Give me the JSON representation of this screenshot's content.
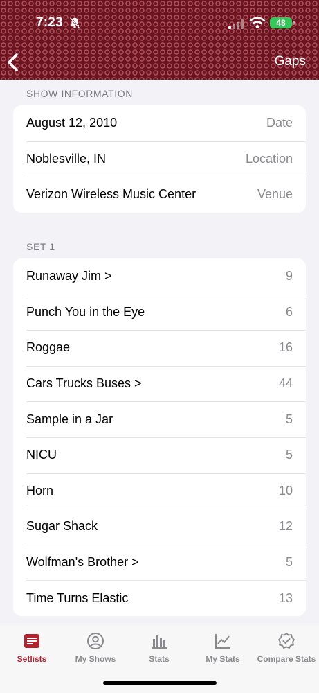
{
  "status_bar": {
    "time": "7:23",
    "battery": "48"
  },
  "nav": {
    "right_button": "Gaps"
  },
  "show_info": {
    "header": "SHOW INFORMATION",
    "rows": [
      {
        "title": "August 12, 2010",
        "value": "Date"
      },
      {
        "title": "Noblesville, IN",
        "value": "Location"
      },
      {
        "title": "Verizon Wireless Music Center",
        "value": "Venue"
      }
    ]
  },
  "set1": {
    "header": "SET 1",
    "songs": [
      {
        "title": "Runaway Jim >",
        "gap": "9"
      },
      {
        "title": "Punch You in the Eye",
        "gap": "6"
      },
      {
        "title": "Roggae",
        "gap": "16"
      },
      {
        "title": "Cars Trucks Buses >",
        "gap": "44"
      },
      {
        "title": "Sample in a Jar",
        "gap": "5"
      },
      {
        "title": "NICU",
        "gap": "5"
      },
      {
        "title": "Horn",
        "gap": "10"
      },
      {
        "title": "Sugar Shack",
        "gap": "12"
      },
      {
        "title": "Wolfman's Brother >",
        "gap": "5"
      },
      {
        "title": "Time Turns Elastic",
        "gap": "13"
      }
    ]
  },
  "tabs": [
    {
      "label": "Setlists",
      "icon": "setlists-icon",
      "active": true
    },
    {
      "label": "My Shows",
      "icon": "person-circle-icon",
      "active": false
    },
    {
      "label": "Stats",
      "icon": "bar-chart-icon",
      "active": false
    },
    {
      "label": "My Stats",
      "icon": "line-chart-icon",
      "active": false
    },
    {
      "label": "Compare Stats",
      "icon": "checkmark-seal-icon",
      "active": false
    }
  ],
  "colors": {
    "accent": "#b0232f",
    "header_bg": "#6b1420",
    "battery": "#34c759"
  }
}
